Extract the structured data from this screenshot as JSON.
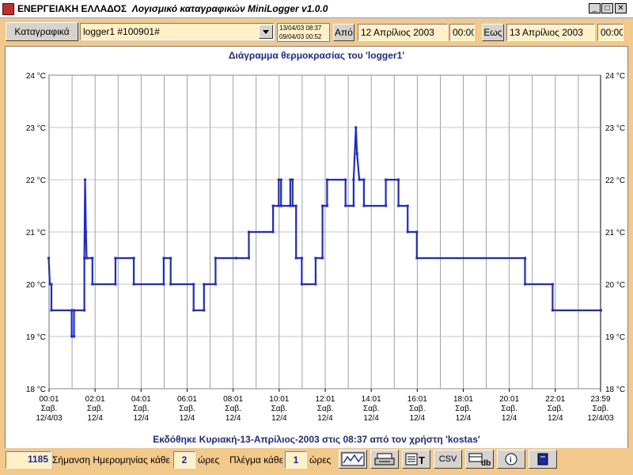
{
  "window": {
    "title_part1": "ΕΝΕΡΓΕΙΑΚΗ ΕΛΛΑΔΟΣ",
    "title_part2": "Λογισμικό καταγραφικών MiniLogger v1.0.0"
  },
  "toolbar": {
    "loggers_button": "Καταγραφικά",
    "logger_select": "logger1 #100901#",
    "date_line1": "13/04/03 08:37",
    "date_line2": "09/04/03 00:52",
    "from_label": "Από",
    "from_date": "12 Απρίλιος 2003",
    "from_time": "00:00",
    "to_label": "Εως",
    "to_date": "13 Απρίλιος 2003",
    "to_time": "00:00"
  },
  "chart_data": {
    "type": "line",
    "title": "Διάγραμμα θερμοκρασίας του 'logger1'",
    "ylim": [
      18,
      24
    ],
    "yticks": [
      "24 °C",
      "23 °C",
      "22 °C",
      "21 °C",
      "20 °C",
      "19 °C",
      "18 °C"
    ],
    "ytick_values": [
      24,
      23,
      22,
      21,
      20,
      19,
      18
    ],
    "grid": true,
    "xlim": [
      0.0167,
      23.983
    ],
    "xticks": [
      {
        "x": 0.0167,
        "time": "00:01",
        "day": "Σαβ.",
        "date": "12/4/03"
      },
      {
        "x": 2.0167,
        "time": "02:01",
        "day": "Σαβ.",
        "date": "12/4"
      },
      {
        "x": 4.0167,
        "time": "04:01",
        "day": "Σαβ.",
        "date": "12/4"
      },
      {
        "x": 6.0167,
        "time": "06:01",
        "day": "Σαβ.",
        "date": "12/4"
      },
      {
        "x": 8.0167,
        "time": "08:01",
        "day": "Σαβ.",
        "date": "12/4"
      },
      {
        "x": 10.0167,
        "time": "10:01",
        "day": "Σαβ.",
        "date": "12/4"
      },
      {
        "x": 12.0167,
        "time": "12:01",
        "day": "Σαβ.",
        "date": "12/4"
      },
      {
        "x": 14.0167,
        "time": "14:01",
        "day": "Σαβ.",
        "date": "12/4"
      },
      {
        "x": 16.0167,
        "time": "16:01",
        "day": "Σαβ.",
        "date": "12/4"
      },
      {
        "x": 18.0167,
        "time": "18:01",
        "day": "Σαβ.",
        "date": "12/4"
      },
      {
        "x": 20.0167,
        "time": "20:01",
        "day": "Σαβ.",
        "date": "12/4"
      },
      {
        "x": 22.0167,
        "time": "22:01",
        "day": "Σαβ.",
        "date": "12/4"
      },
      {
        "x": 23.983,
        "time": "23:59",
        "day": "Σαβ.",
        "date": "12/4/03"
      }
    ],
    "series": [
      {
        "color": "#1f2bd0",
        "points": [
          [
            0.0,
            20.5
          ],
          [
            0.05,
            20.0
          ],
          [
            0.12,
            20.0
          ],
          [
            0.12,
            19.5
          ],
          [
            1.0,
            19.5
          ],
          [
            1.0,
            19.0
          ],
          [
            1.1,
            19.0
          ],
          [
            1.1,
            19.5
          ],
          [
            1.55,
            19.5
          ],
          [
            1.55,
            20.5
          ],
          [
            1.58,
            22.0
          ],
          [
            1.62,
            21.0
          ],
          [
            1.65,
            20.5
          ],
          [
            1.9,
            20.5
          ],
          [
            1.9,
            20.0
          ],
          [
            2.9,
            20.0
          ],
          [
            2.9,
            20.5
          ],
          [
            3.7,
            20.5
          ],
          [
            3.7,
            20.0
          ],
          [
            5.0,
            20.0
          ],
          [
            5.0,
            20.5
          ],
          [
            5.3,
            20.5
          ],
          [
            5.3,
            20.0
          ],
          [
            6.3,
            20.0
          ],
          [
            6.3,
            19.5
          ],
          [
            6.75,
            19.5
          ],
          [
            6.75,
            20.0
          ],
          [
            7.25,
            20.0
          ],
          [
            7.25,
            20.5
          ],
          [
            8.15,
            20.5
          ],
          [
            8.15,
            20.5
          ],
          [
            8.7,
            20.5
          ],
          [
            8.7,
            21.0
          ],
          [
            9.75,
            21.0
          ],
          [
            9.75,
            21.5
          ],
          [
            10.0,
            21.5
          ],
          [
            10.0,
            22.0
          ],
          [
            10.1,
            22.0
          ],
          [
            10.1,
            21.5
          ],
          [
            10.5,
            21.5
          ],
          [
            10.5,
            22.0
          ],
          [
            10.6,
            22.0
          ],
          [
            10.6,
            21.5
          ],
          [
            10.75,
            21.5
          ],
          [
            10.75,
            20.5
          ],
          [
            11.0,
            20.5
          ],
          [
            11.0,
            20.0
          ],
          [
            11.6,
            20.0
          ],
          [
            11.6,
            20.5
          ],
          [
            11.9,
            20.5
          ],
          [
            11.9,
            21.5
          ],
          [
            12.1,
            21.5
          ],
          [
            12.1,
            22.0
          ],
          [
            12.9,
            22.0
          ],
          [
            12.9,
            21.5
          ],
          [
            13.25,
            21.5
          ],
          [
            13.25,
            22.0
          ],
          [
            13.35,
            23.0
          ],
          [
            13.4,
            22.5
          ],
          [
            13.5,
            22.0
          ],
          [
            13.7,
            22.0
          ],
          [
            13.7,
            21.5
          ],
          [
            14.65,
            21.5
          ],
          [
            14.65,
            22.0
          ],
          [
            15.2,
            22.0
          ],
          [
            15.2,
            21.5
          ],
          [
            15.6,
            21.5
          ],
          [
            15.6,
            21.0
          ],
          [
            16.0,
            21.0
          ],
          [
            16.0,
            20.5
          ],
          [
            20.7,
            20.5
          ],
          [
            20.7,
            20.0
          ],
          [
            21.9,
            20.0
          ],
          [
            21.9,
            19.5
          ],
          [
            24.0,
            19.5
          ]
        ]
      }
    ]
  },
  "footer_text": "Εκδόθηκε Κυριακή-13-Απρίλιος-2003 στις 08:37 από τον χρήστη 'kostas'",
  "statusbar": {
    "record_count": "1185",
    "date_mark_label": "Σήμανση Ημερομηνίας κάθε",
    "date_mark_value": "2",
    "date_mark_unit": "ώρες",
    "grid_label": "Πλέγμα κάθε",
    "grid_value": "1",
    "grid_unit": "ώρες",
    "csv_button": "CSV",
    "db_label": "db"
  }
}
